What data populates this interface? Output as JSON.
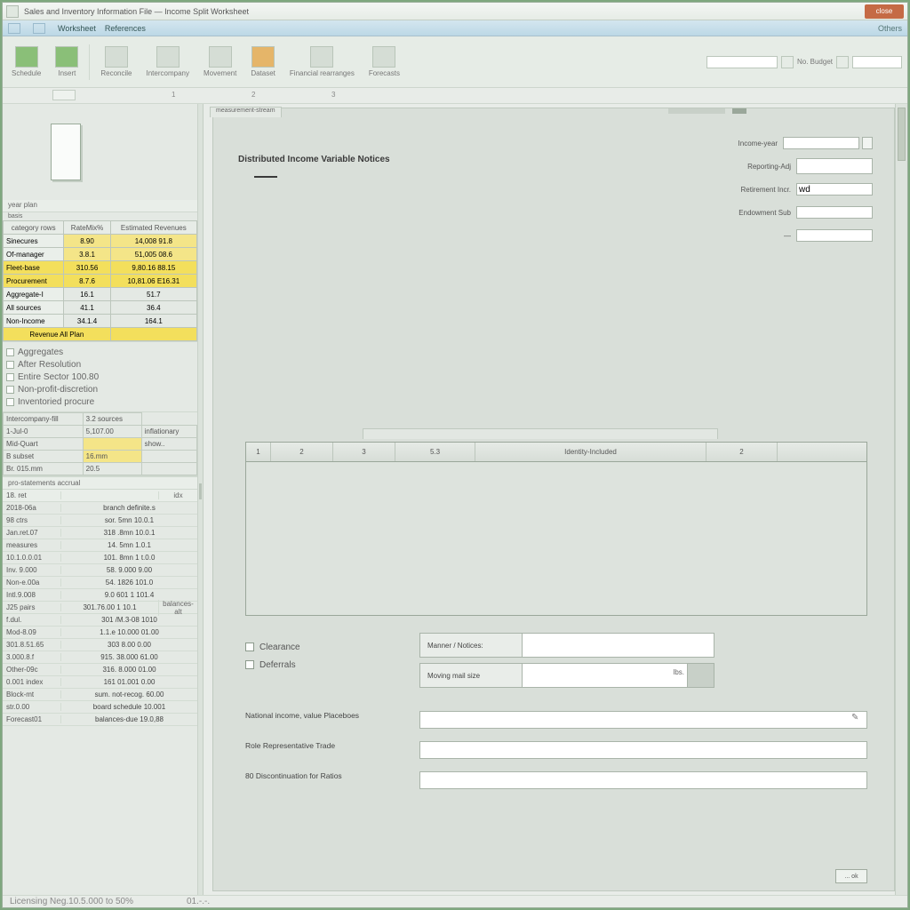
{
  "title": "Sales and Inventory Information File — Income Split Worksheet",
  "close": "close",
  "menu": {
    "i1": "Worksheet",
    "i2": "References",
    "right": "Others"
  },
  "ribbon": {
    "g1": "Schedule",
    "g2": "Insert",
    "g3": "Reconcile",
    "g4": "Intercompany",
    "g5": "Movement",
    "g6": "Dataset",
    "g7": "Financial rearranges",
    "g8": "Forecasts",
    "find": "No. Budget",
    "quick_ph": ""
  },
  "left": {
    "head1": "year plan",
    "mini": "basis",
    "table_headers": [
      "category rows",
      "RateMix%",
      "Estimated Revenues"
    ],
    "rows": [
      {
        "label": "Sinecures",
        "c2": "8.90",
        "c3": "14,008   91.8",
        "hl": true
      },
      {
        "label": "Of-manager",
        "c2": "3.8.1",
        "c3": "51,005   08.6",
        "hl": true
      },
      {
        "label": "Fleet-base",
        "c2": "310.56",
        "c3": "9,80.16  88.15",
        "hl": true,
        "br": true
      },
      {
        "label": "Procurement",
        "c2": "8.7.6",
        "c3": "10,81.06 E16.31",
        "hl": true,
        "br": true
      },
      {
        "label": "Aggregate-I",
        "c2": "16.1",
        "c3": "51.7",
        "hl": false
      },
      {
        "label": "All sources",
        "c2": "41.1",
        "c3": "36.4",
        "hl": false
      },
      {
        "label": "Non-Income",
        "c2": "34.1.4",
        "c3": "164.1",
        "hl": false
      }
    ],
    "span_row": "Revenue All Plan",
    "checks": [
      "Aggregates",
      "After Resolution",
      "Entire Sector 100.80",
      "Non-profit-discretion",
      "Inventoried procure"
    ],
    "two_col": [
      [
        "Intercompany-fill",
        "3.2 sources"
      ],
      [
        "1-Jul-0",
        "5,107.00",
        "inflationary"
      ],
      [
        "Mid-Quart",
        "",
        "show.."
      ],
      [
        "B subset",
        "16.mm",
        ""
      ],
      [
        "Br. 015.mm",
        "20.5",
        ""
      ]
    ],
    "sub_head": "pro-statements accrual",
    "list_head": [
      "18.  ret",
      "",
      "idx"
    ],
    "list": [
      [
        "2018-06a",
        "branch definite.s",
        ""
      ],
      [
        "98 ctrs",
        "sor. 5mn  10.0.1",
        ""
      ],
      [
        "Jan.ret.07",
        "318  .8mn  10.0.1",
        ""
      ],
      [
        "measures",
        "14.  5mn  1.0.1",
        ""
      ],
      [
        "10.1.0.0.01",
        "101. 8mn 1 t.0.0",
        ""
      ],
      [
        "Inv. 9.000",
        "58. 9.000  9.00",
        ""
      ],
      [
        "Non-e.00a",
        "54. 1826  101.0",
        ""
      ],
      [
        "Intl.9.008",
        "9.0 601 1 101.4",
        ""
      ],
      [
        "J25 pairs",
        "301.76.00 1 10.1",
        "balances-alt"
      ],
      [
        "f.dul.",
        "301 /M.3-08  1010",
        ""
      ],
      [
        "Mod-8.09",
        "1.1.e  10.000  01.00",
        ""
      ],
      [
        "301.8.51.65",
        "303  8.00  0.00",
        ""
      ],
      [
        "3.000.8.f",
        "915. 38.000  61.00",
        ""
      ],
      [
        "Other-09c",
        "316.  8.000  01.00",
        ""
      ],
      [
        "0.001 index",
        "161  01.001  0.00",
        ""
      ],
      [
        "Block-mt",
        "sum. not-recog. 60.00",
        ""
      ],
      [
        "str.0.00",
        "board schedule 10.001",
        ""
      ],
      [
        "Forecast01",
        "balances-due 19.0,88",
        ""
      ]
    ],
    "foot": "Licensing Neg.10.5.000 to 50%"
  },
  "panel": {
    "tab": "measurement-stream",
    "heading": "Distributed Income Variable Notices",
    "top_form": [
      {
        "label": "Income-year",
        "val": ""
      },
      {
        "label": "Reporting-Adj",
        "val": ""
      },
      {
        "label": "Retirement Incr.",
        "val": "wd"
      },
      {
        "label": "Endowment Sub",
        "val": ""
      },
      {
        "label": "—",
        "val": ""
      }
    ],
    "grid_cols": [
      "1",
      "2",
      "3",
      "5.3",
      "Identity-Included",
      "2"
    ],
    "checks": [
      "Clearance",
      "Deferrals"
    ],
    "pair": [
      {
        "label": "Manner / Notices:",
        "val": ""
      },
      {
        "label": "Moving mail size",
        "val": "",
        "unit": "lbs."
      }
    ],
    "wide": [
      {
        "label": "National income, value Placeboes",
        "pen": true
      },
      {
        "label": "Role Representative Trade",
        "pen": false
      },
      {
        "label": "80 Discontinuation for Ratios",
        "pen": false
      }
    ],
    "action": "... ok"
  },
  "status": {
    "s1": "",
    "s2": "01.-.-."
  }
}
